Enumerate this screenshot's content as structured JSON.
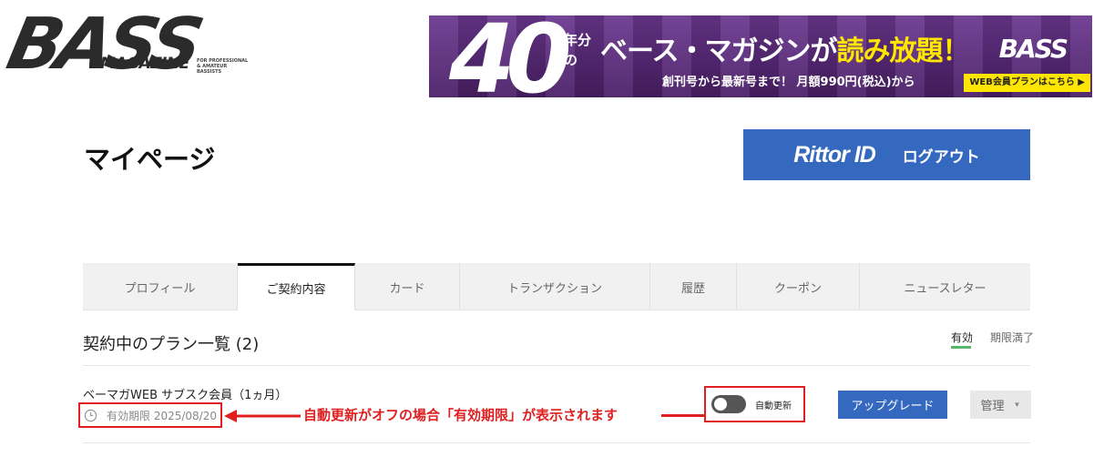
{
  "header": {
    "logo_text": "BASS",
    "logo_sub": "MAGAZINE",
    "logo_tagline": "FOR PROFESSIONAL & AMATEUR BASSISTS"
  },
  "banner": {
    "number": "40",
    "small": "年分の",
    "headline_pre": "ベース・マガジンが",
    "headline_highlight": "読み放題！",
    "logo": "BASS",
    "sub": "創刊号から最新号まで！ 月額990円(税込)から",
    "cta": "WEB会員プランはこちら ▶"
  },
  "page": {
    "title": "マイページ"
  },
  "logout": {
    "brand": "Rittor ID",
    "label": "ログアウト"
  },
  "tabs": [
    {
      "label": "プロフィール"
    },
    {
      "label": "ご契約内容"
    },
    {
      "label": "カード"
    },
    {
      "label": "トランザクション"
    },
    {
      "label": "履歴"
    },
    {
      "label": "クーポン"
    },
    {
      "label": "ニュースレター"
    }
  ],
  "plans": {
    "heading": "契約中のプラン一覧 (2)",
    "filter_active": "有効",
    "filter_expired": "期限満了",
    "items": [
      {
        "name": "ベーマガWEB サブスク会員（1ヵ月）",
        "expiry": "有効期限 2025/08/20",
        "auto_renew_label": "自動更新",
        "auto_renew_on": false,
        "upgrade_label": "アップグレード",
        "manage_label": "管理"
      }
    ]
  },
  "annotation": {
    "text": "自動更新がオフの場合「有効期限」が表示されます",
    "color": "#e02020"
  },
  "colors": {
    "primary": "#3569c0",
    "accent_green": "#52b86a",
    "annotation_red": "#e02020",
    "banner_purple": "#5a2a7a"
  }
}
